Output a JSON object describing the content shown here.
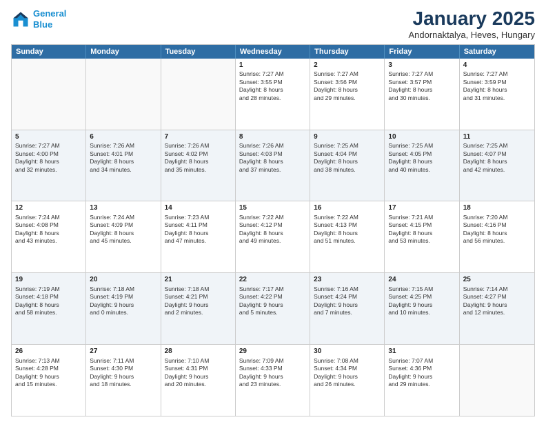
{
  "header": {
    "logo_line1": "General",
    "logo_line2": "Blue",
    "title": "January 2025",
    "subtitle": "Andornaktalya, Heves, Hungary"
  },
  "weekdays": [
    "Sunday",
    "Monday",
    "Tuesday",
    "Wednesday",
    "Thursday",
    "Friday",
    "Saturday"
  ],
  "rows": [
    [
      {
        "day": "",
        "text": ""
      },
      {
        "day": "",
        "text": ""
      },
      {
        "day": "",
        "text": ""
      },
      {
        "day": "1",
        "text": "Sunrise: 7:27 AM\nSunset: 3:55 PM\nDaylight: 8 hours\nand 28 minutes."
      },
      {
        "day": "2",
        "text": "Sunrise: 7:27 AM\nSunset: 3:56 PM\nDaylight: 8 hours\nand 29 minutes."
      },
      {
        "day": "3",
        "text": "Sunrise: 7:27 AM\nSunset: 3:57 PM\nDaylight: 8 hours\nand 30 minutes."
      },
      {
        "day": "4",
        "text": "Sunrise: 7:27 AM\nSunset: 3:59 PM\nDaylight: 8 hours\nand 31 minutes."
      }
    ],
    [
      {
        "day": "5",
        "text": "Sunrise: 7:27 AM\nSunset: 4:00 PM\nDaylight: 8 hours\nand 32 minutes."
      },
      {
        "day": "6",
        "text": "Sunrise: 7:26 AM\nSunset: 4:01 PM\nDaylight: 8 hours\nand 34 minutes."
      },
      {
        "day": "7",
        "text": "Sunrise: 7:26 AM\nSunset: 4:02 PM\nDaylight: 8 hours\nand 35 minutes."
      },
      {
        "day": "8",
        "text": "Sunrise: 7:26 AM\nSunset: 4:03 PM\nDaylight: 8 hours\nand 37 minutes."
      },
      {
        "day": "9",
        "text": "Sunrise: 7:25 AM\nSunset: 4:04 PM\nDaylight: 8 hours\nand 38 minutes."
      },
      {
        "day": "10",
        "text": "Sunrise: 7:25 AM\nSunset: 4:05 PM\nDaylight: 8 hours\nand 40 minutes."
      },
      {
        "day": "11",
        "text": "Sunrise: 7:25 AM\nSunset: 4:07 PM\nDaylight: 8 hours\nand 42 minutes."
      }
    ],
    [
      {
        "day": "12",
        "text": "Sunrise: 7:24 AM\nSunset: 4:08 PM\nDaylight: 8 hours\nand 43 minutes."
      },
      {
        "day": "13",
        "text": "Sunrise: 7:24 AM\nSunset: 4:09 PM\nDaylight: 8 hours\nand 45 minutes."
      },
      {
        "day": "14",
        "text": "Sunrise: 7:23 AM\nSunset: 4:11 PM\nDaylight: 8 hours\nand 47 minutes."
      },
      {
        "day": "15",
        "text": "Sunrise: 7:22 AM\nSunset: 4:12 PM\nDaylight: 8 hours\nand 49 minutes."
      },
      {
        "day": "16",
        "text": "Sunrise: 7:22 AM\nSunset: 4:13 PM\nDaylight: 8 hours\nand 51 minutes."
      },
      {
        "day": "17",
        "text": "Sunrise: 7:21 AM\nSunset: 4:15 PM\nDaylight: 8 hours\nand 53 minutes."
      },
      {
        "day": "18",
        "text": "Sunrise: 7:20 AM\nSunset: 4:16 PM\nDaylight: 8 hours\nand 56 minutes."
      }
    ],
    [
      {
        "day": "19",
        "text": "Sunrise: 7:19 AM\nSunset: 4:18 PM\nDaylight: 8 hours\nand 58 minutes."
      },
      {
        "day": "20",
        "text": "Sunrise: 7:18 AM\nSunset: 4:19 PM\nDaylight: 9 hours\nand 0 minutes."
      },
      {
        "day": "21",
        "text": "Sunrise: 7:18 AM\nSunset: 4:21 PM\nDaylight: 9 hours\nand 2 minutes."
      },
      {
        "day": "22",
        "text": "Sunrise: 7:17 AM\nSunset: 4:22 PM\nDaylight: 9 hours\nand 5 minutes."
      },
      {
        "day": "23",
        "text": "Sunrise: 7:16 AM\nSunset: 4:24 PM\nDaylight: 9 hours\nand 7 minutes."
      },
      {
        "day": "24",
        "text": "Sunrise: 7:15 AM\nSunset: 4:25 PM\nDaylight: 9 hours\nand 10 minutes."
      },
      {
        "day": "25",
        "text": "Sunrise: 7:14 AM\nSunset: 4:27 PM\nDaylight: 9 hours\nand 12 minutes."
      }
    ],
    [
      {
        "day": "26",
        "text": "Sunrise: 7:13 AM\nSunset: 4:28 PM\nDaylight: 9 hours\nand 15 minutes."
      },
      {
        "day": "27",
        "text": "Sunrise: 7:11 AM\nSunset: 4:30 PM\nDaylight: 9 hours\nand 18 minutes."
      },
      {
        "day": "28",
        "text": "Sunrise: 7:10 AM\nSunset: 4:31 PM\nDaylight: 9 hours\nand 20 minutes."
      },
      {
        "day": "29",
        "text": "Sunrise: 7:09 AM\nSunset: 4:33 PM\nDaylight: 9 hours\nand 23 minutes."
      },
      {
        "day": "30",
        "text": "Sunrise: 7:08 AM\nSunset: 4:34 PM\nDaylight: 9 hours\nand 26 minutes."
      },
      {
        "day": "31",
        "text": "Sunrise: 7:07 AM\nSunset: 4:36 PM\nDaylight: 9 hours\nand 29 minutes."
      },
      {
        "day": "",
        "text": ""
      }
    ]
  ]
}
